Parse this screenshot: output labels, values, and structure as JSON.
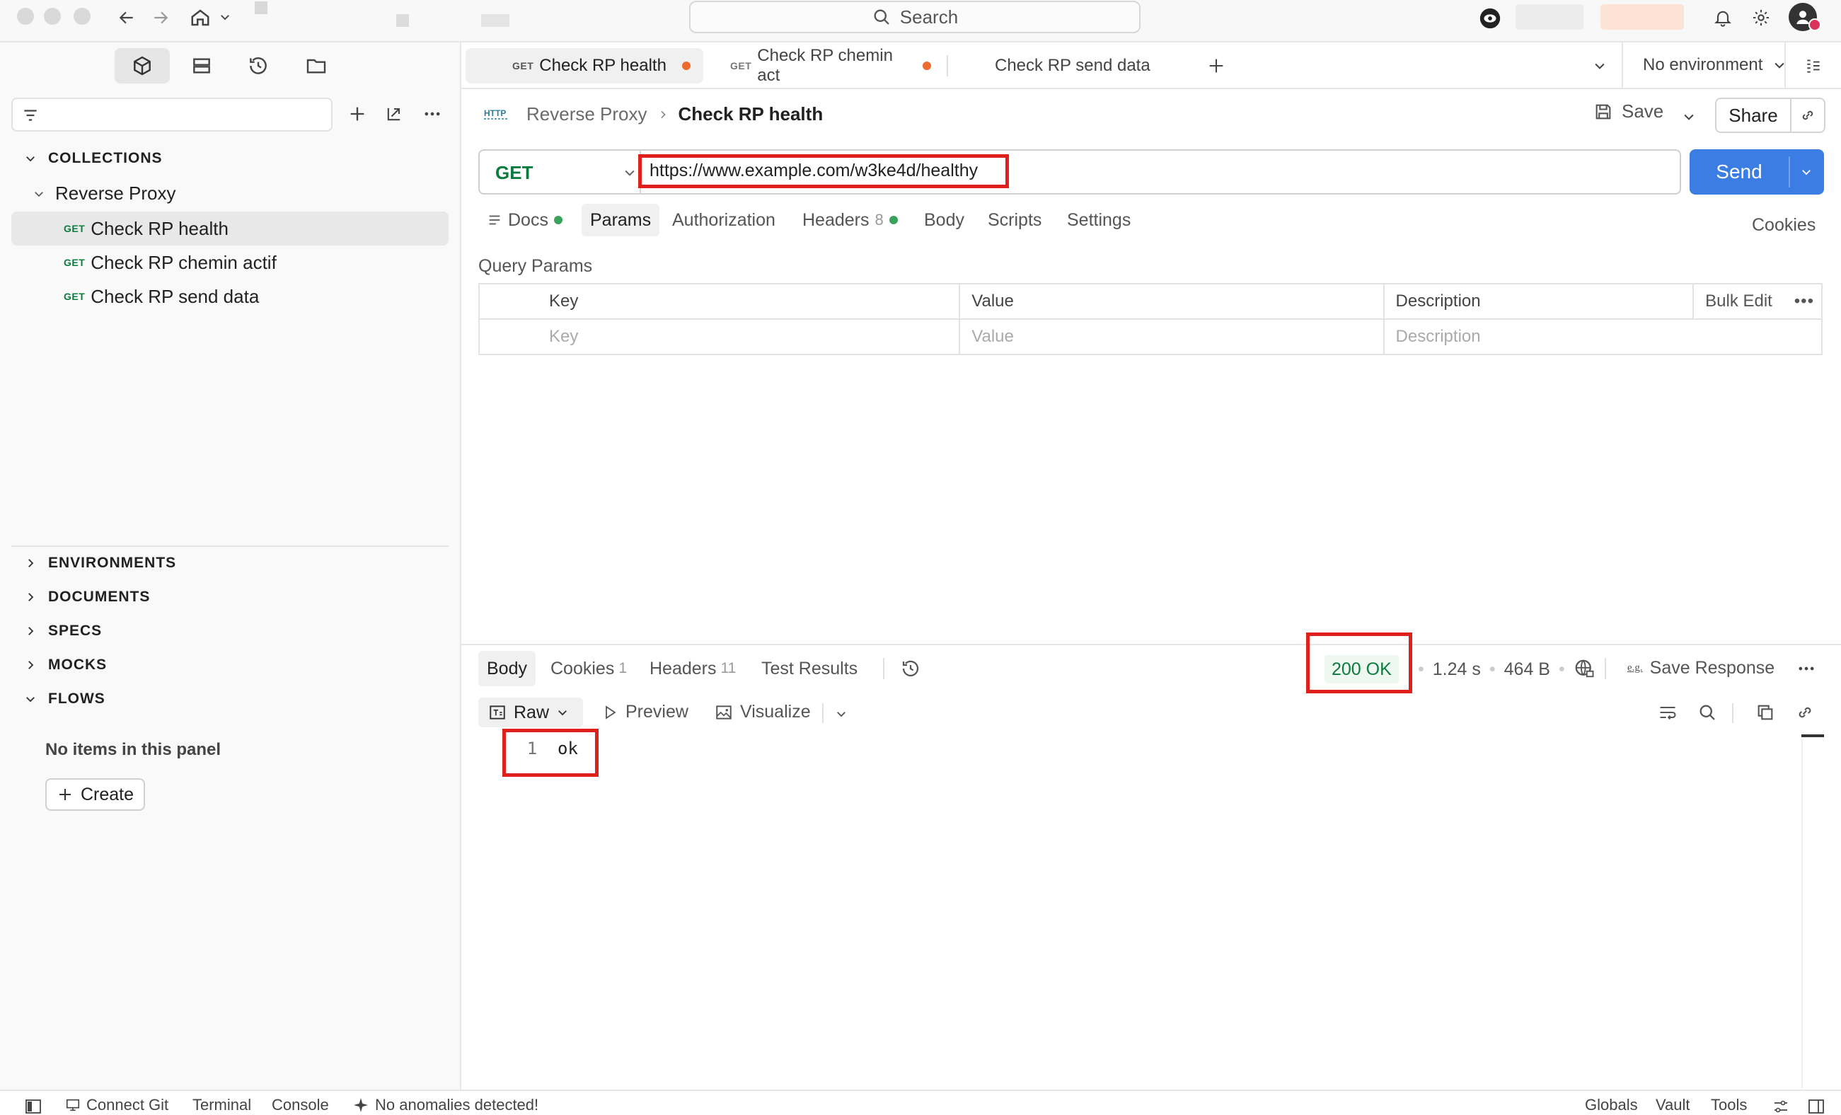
{
  "titlebar": {
    "search_label": "Search"
  },
  "sidebar": {
    "sections": {
      "collections": "COLLECTIONS",
      "environments": "ENVIRONMENTS",
      "documents": "DOCUMENTS",
      "specs": "SPECS",
      "mocks": "MOCKS",
      "flows": "FLOWS"
    },
    "folder": "Reverse Proxy",
    "items": [
      {
        "method": "GET",
        "label": "Check RP health"
      },
      {
        "method": "GET",
        "label": "Check RP chemin actif"
      },
      {
        "method": "GET",
        "label": "Check RP send data"
      }
    ],
    "flows_empty": "No items in this panel",
    "create_label": "Create"
  },
  "tabs": [
    {
      "method": "GET",
      "label": "Check RP health"
    },
    {
      "method": "GET",
      "label": "Check RP chemin act"
    },
    {
      "method": "",
      "label": "Check RP send data"
    }
  ],
  "environment": "No environment",
  "breadcrumb": {
    "parent": "Reverse Proxy",
    "current": "Check RP health"
  },
  "actions": {
    "save": "Save",
    "share": "Share"
  },
  "request": {
    "method": "GET",
    "url": "https://www.example.com/w3ke4d/healthy",
    "send": "Send",
    "tabs": {
      "docs": "Docs",
      "params": "Params",
      "authorization": "Authorization",
      "headers": "Headers",
      "headers_count": "8",
      "body": "Body",
      "scripts": "Scripts",
      "settings": "Settings"
    },
    "cookies": "Cookies",
    "query_params_title": "Query Params",
    "columns": {
      "key": "Key",
      "value": "Value",
      "description": "Description",
      "bulk_edit": "Bulk Edit"
    },
    "placeholders": {
      "key": "Key",
      "value": "Value",
      "description": "Description"
    }
  },
  "response": {
    "tabs": {
      "body": "Body",
      "cookies": "Cookies",
      "cookies_count": "1",
      "headers": "Headers",
      "headers_count": "11",
      "test_results": "Test Results"
    },
    "status": "200 OK",
    "time": "1.24 s",
    "size": "464 B",
    "save_response": "Save Response",
    "eg_label": "e.g.",
    "view": {
      "raw": "Raw",
      "preview": "Preview",
      "visualize": "Visualize"
    },
    "line_number": "1",
    "body_text": "ok"
  },
  "statusbar": {
    "connect_git": "Connect Git",
    "terminal": "Terminal",
    "console": "Console",
    "anomalies": "No anomalies detected!",
    "globals": "Globals",
    "vault": "Vault",
    "tools": "Tools"
  },
  "colors": {
    "accent_blue": "#3b7de3",
    "get_green": "#0c7b3e",
    "unsaved_orange": "#ee6b2f",
    "status_ok_green": "#0c7b3e",
    "highlight_red": "#e0201b"
  }
}
